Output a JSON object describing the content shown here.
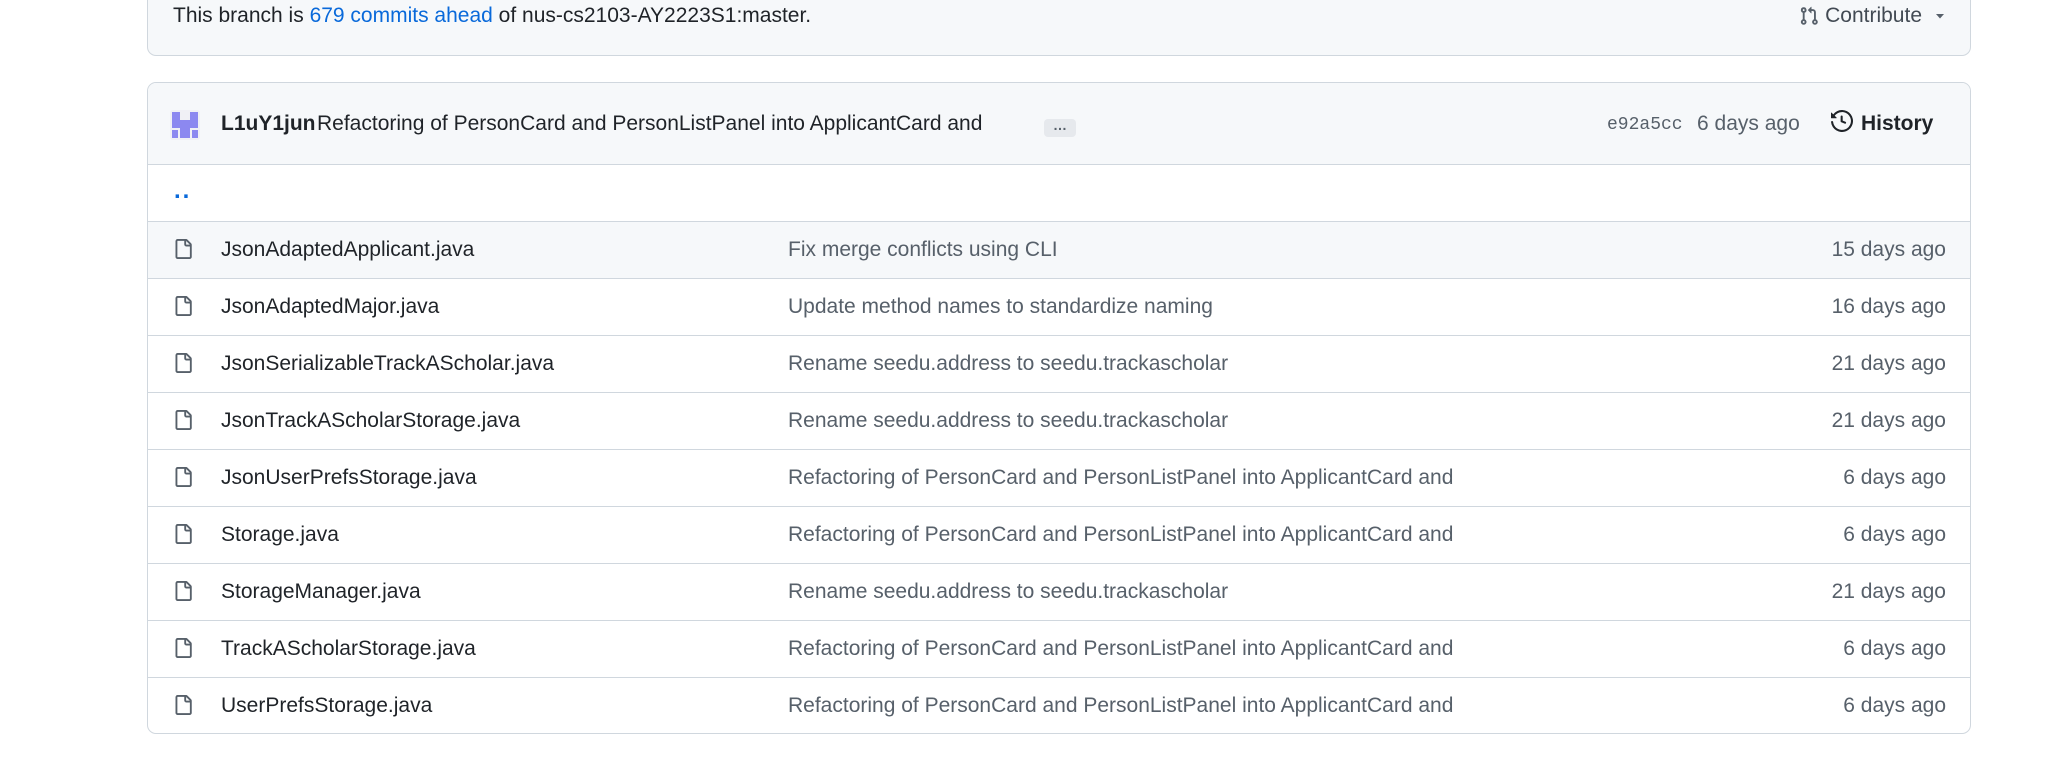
{
  "branch": {
    "prefix": "This branch is ",
    "ahead_link": "679 commits ahead",
    "suffix": " of nus-cs2103-AY2223S1:master.",
    "contribute_label": "Contribute"
  },
  "latest_commit": {
    "author": "L1uY1jun",
    "message": "Refactoring of PersonCard and PersonListPanel into ApplicantCard and",
    "ellipsis": "…",
    "sha": "e92a5cc",
    "date": "6 days ago",
    "history_label": "History"
  },
  "parent_dir": "..",
  "files": [
    {
      "name": "JsonAdaptedApplicant.java",
      "commit": "Fix merge conflicts using CLI",
      "date": "15 days ago"
    },
    {
      "name": "JsonAdaptedMajor.java",
      "commit": "Update method names to standardize naming",
      "date": "16 days ago"
    },
    {
      "name": "JsonSerializableTrackAScholar.java",
      "commit": "Rename seedu.address to seedu.trackascholar",
      "date": "21 days ago"
    },
    {
      "name": "JsonTrackAScholarStorage.java",
      "commit": "Rename seedu.address to seedu.trackascholar",
      "date": "21 days ago"
    },
    {
      "name": "JsonUserPrefsStorage.java",
      "commit": "Refactoring of PersonCard and PersonListPanel into ApplicantCard and",
      "date": "6 days ago"
    },
    {
      "name": "Storage.java",
      "commit": "Refactoring of PersonCard and PersonListPanel into ApplicantCard and",
      "date": "6 days ago"
    },
    {
      "name": "StorageManager.java",
      "commit": "Rename seedu.address to seedu.trackascholar",
      "date": "21 days ago"
    },
    {
      "name": "TrackAScholarStorage.java",
      "commit": "Refactoring of PersonCard and PersonListPanel into ApplicantCard and",
      "date": "6 days ago"
    },
    {
      "name": "UserPrefsStorage.java",
      "commit": "Refactoring of PersonCard and PersonListPanel into ApplicantCard and",
      "date": "6 days ago"
    }
  ],
  "icons": {
    "file": "file-icon",
    "pull_request": "git-pull-request-icon",
    "history": "history-clock-icon",
    "caret": "caret-down-icon"
  },
  "colors": {
    "link": "#0969da",
    "muted": "#57606a",
    "border": "#d0d7de",
    "header_bg": "#f6f8fa",
    "avatar": "#8c88f0"
  }
}
